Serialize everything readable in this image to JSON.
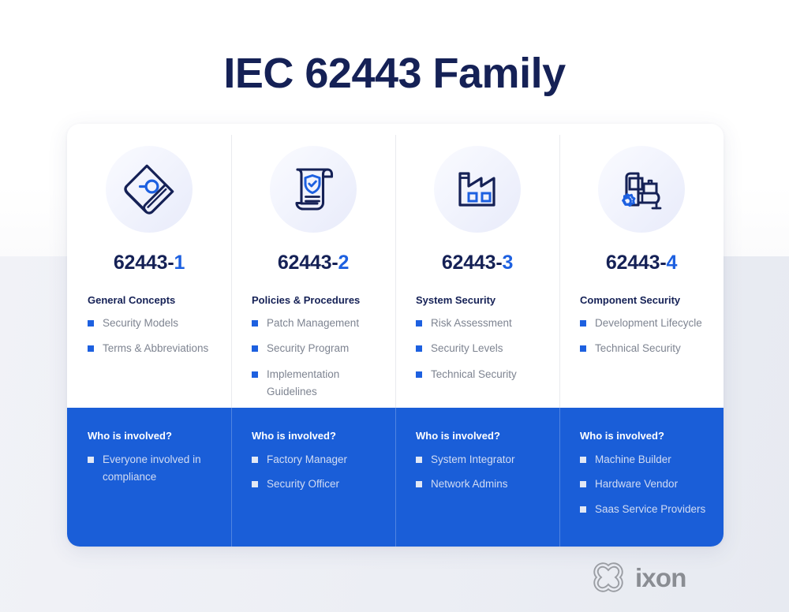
{
  "page": {
    "title": "IEC 62443 Family",
    "accent_blue": "#1d60e0",
    "band_blue": "#1a5ed8",
    "navy": "#152156",
    "body_grey": "#7e8491",
    "bg_top": "#ffffff",
    "bg_bottom": "#eceef4"
  },
  "columns": [
    {
      "icon": "book-with-magnifier-icon",
      "code_base": "62443-",
      "code_suffix": "1",
      "sub_title": "General Concepts",
      "items": [
        "Security Models",
        "Terms & Abbreviations"
      ],
      "involved_title": "Who is involved?",
      "people": [
        "Everyone involved in compliance"
      ]
    },
    {
      "icon": "scroll-with-shield-icon",
      "code_base": "62443-",
      "code_suffix": "2",
      "sub_title": "Policies & Procedures",
      "items": [
        "Patch Management",
        "Security Program",
        "Implementation Guidelines"
      ],
      "involved_title": "Who is involved?",
      "people": [
        "Factory Manager",
        "Security Officer"
      ]
    },
    {
      "icon": "factory-icon",
      "code_base": "62443-",
      "code_suffix": "3",
      "sub_title": "System Security",
      "items": [
        "Risk Assessment",
        "Security Levels",
        "Technical Security"
      ],
      "involved_title": "Who is involved?",
      "people": [
        "System Integrator",
        "Network Admins"
      ]
    },
    {
      "icon": "conveyor-machine-with-gear-icon",
      "code_base": "62443-",
      "code_suffix": "4",
      "sub_title": "Component Security",
      "items": [
        "Development Lifecycle",
        "Technical Security"
      ],
      "involved_title": "Who is involved?",
      "people": [
        "Machine Builder",
        "Hardware Vendor",
        "Saas Service Providers"
      ]
    }
  ],
  "footer": {
    "logo_mark": "ixon-x-mark-icon",
    "logo_text": "ixon"
  }
}
